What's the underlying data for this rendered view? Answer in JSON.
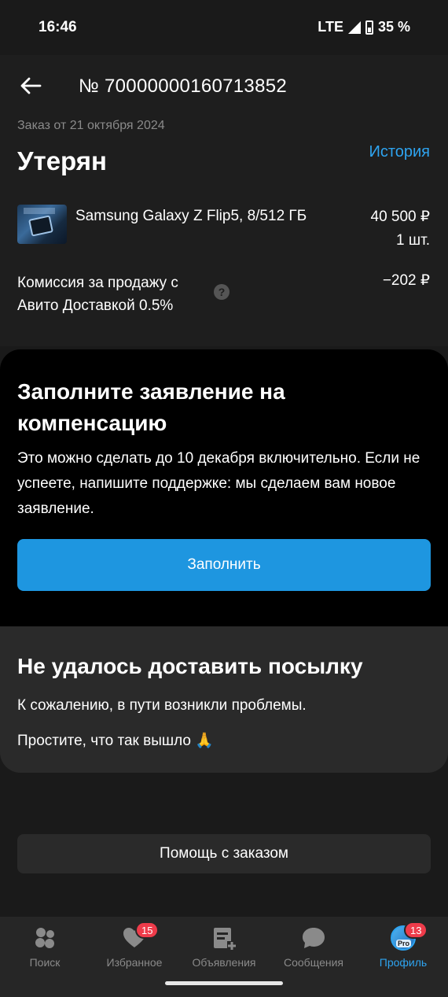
{
  "status_bar": {
    "time": "16:46",
    "network": "LTE",
    "battery": "35 %"
  },
  "header": {
    "title": "№ 70000000160713852"
  },
  "order": {
    "date": "Заказ от 21 октября 2024",
    "status": "Утерян",
    "history_link": "История",
    "product": {
      "name": "Samsung Galaxy Z Flip5, 8/512 ГБ",
      "price": "40 500 ₽",
      "quantity": "1 шт."
    },
    "commission": {
      "label": "Комиссия за продажу с Авито Доставкой 0.5%",
      "value": "−202 ₽",
      "help_symbol": "?"
    }
  },
  "claim": {
    "title": "Заполните заявление на компенсацию",
    "text": "Это можно сделать до 10 декабря включительно. Если не успеете, напишите поддержке: мы сделаем вам новое заявление.",
    "button_label": "Заполнить"
  },
  "delivery": {
    "title": "Не удалось доставить посылку",
    "text1": "К сожалению, в пути возникли проблемы.",
    "text2": "Простите, что так вышло 🙏"
  },
  "help_button_label": "Помощь с заказом",
  "bottom_nav": {
    "items": [
      {
        "label": "Поиск",
        "icon": "search-dots-icon"
      },
      {
        "label": "Избранное",
        "icon": "heart-icon",
        "badge": "15"
      },
      {
        "label": "Объявления",
        "icon": "ads-icon"
      },
      {
        "label": "Сообщения",
        "icon": "chat-icon"
      },
      {
        "label": "Профиль",
        "icon": "avatar",
        "badge": "13",
        "active": true,
        "avatar_tag": "Pro"
      }
    ]
  },
  "colors": {
    "accent": "#2ea4f0",
    "button": "#1e96e0",
    "badge": "#ee3b4a",
    "background": "#1a1a1a"
  }
}
